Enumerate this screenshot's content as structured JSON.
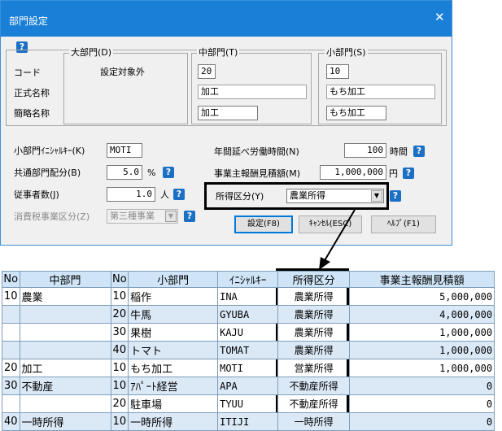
{
  "dialog": {
    "title": "部門設定",
    "close_glyph": "✕",
    "help_glyph": "?",
    "row_labels": {
      "code": "コード",
      "formal_name": "正式名称",
      "short_name": "簡略名称"
    },
    "daibumon": {
      "legend": "大部門(D)",
      "status": "設定対象外"
    },
    "chubumon": {
      "legend": "中部門(T)",
      "code": "20",
      "formal_name": "加工",
      "short_name": "加工"
    },
    "shobumon": {
      "legend": "小部門(S)",
      "code": "10",
      "formal_name": "もち加工",
      "short_name": "もち加工"
    },
    "initial": {
      "label": "小部門ｲﾆｼｬﾙｷｰ(K)",
      "value": "MOTI"
    },
    "common_alloc": {
      "label": "共通部門配分(B)",
      "value": "5.0",
      "unit": "%"
    },
    "workers": {
      "label": "従事者数(J)",
      "value": "1.0",
      "unit": "人"
    },
    "consumption_tax": {
      "label": "消費税事業区分(Z)",
      "value": "第三種事業"
    },
    "annual_hours": {
      "label": "年間延べ労働時間(N)",
      "value": "100",
      "unit": "時間"
    },
    "owner_reward": {
      "label": "事業主報酬見積額(M)",
      "value": "1,000,000",
      "unit": "円"
    },
    "income_class": {
      "label": "所得区分(Y)",
      "value": "農業所得"
    },
    "buttons": {
      "ok": "設定(F8)",
      "cancel": "ｷｬﾝｾﾙ(ESC)",
      "help": "ﾍﾙﾌﾟ(F1)"
    },
    "dropdown_glyph": "▼"
  },
  "table": {
    "headers": [
      "No",
      "中部門",
      "No",
      "小部門",
      "ｲﾆｼｬﾙｷｰ",
      "所得区分",
      "事業主報酬見積額"
    ],
    "rows": [
      [
        "10",
        "農業",
        "10",
        "稲作",
        "INA",
        "農業所得",
        "5,000,000"
      ],
      [
        "",
        "",
        "20",
        "牛馬",
        "GYUBA",
        "農業所得",
        "4,000,000"
      ],
      [
        "",
        "",
        "30",
        "果樹",
        "KAJU",
        "農業所得",
        "1,000,000"
      ],
      [
        "",
        "",
        "40",
        "トマト",
        "TOMAT",
        "農業所得",
        "1,000,000"
      ],
      [
        "20",
        "加工",
        "10",
        "もち加工",
        "MOTI",
        "営業所得",
        "1,000,000"
      ],
      [
        "30",
        "不動産",
        "10",
        "ｱﾊﾟｰﾄ経営",
        "APA",
        "不動産所得",
        "0"
      ],
      [
        "",
        "",
        "20",
        "駐車場",
        "TYUU",
        "不動産所得",
        "0"
      ],
      [
        "40",
        "一時所得",
        "10",
        "一時所得",
        "ITIJI",
        "一時所得",
        "0"
      ]
    ]
  }
}
